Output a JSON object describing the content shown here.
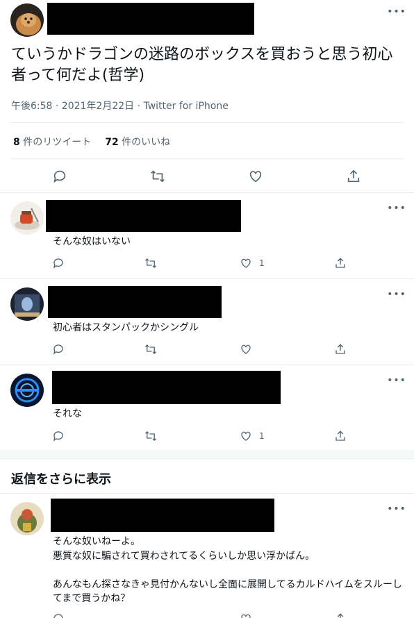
{
  "tweet": {
    "text": "ていうかドラゴンの迷路のボックスを買おうと思う初心者って何だよ(哲学)",
    "meta": "午後6:58 · 2021年2月22日 · Twitter for iPhone",
    "retweets_count": "8",
    "retweets_label": " 件のリツイート",
    "likes_count": "72",
    "likes_label": " 件のいいね"
  },
  "more_glyph": "•••",
  "replies": [
    {
      "text": "そんな奴はいない",
      "likes": "1"
    },
    {
      "text": "初心者はスタンパックかシングル",
      "likes": ""
    },
    {
      "text": "それな",
      "likes": "1"
    }
  ],
  "show_more_label": "返信をさらに表示",
  "extra_reply": {
    "line1": "そんな奴いねーよ。",
    "line2": "悪質な奴に騙されて買わされてるくらいしか思い浮かばん。",
    "line3": "あんなもん探さなきゃ見付かんないし全面に展開してるカルドハイムをスルーしてまで買うかね？"
  },
  "colors": {
    "text": "#0f1419",
    "muted": "#536471",
    "divider": "#e6ecf0"
  }
}
